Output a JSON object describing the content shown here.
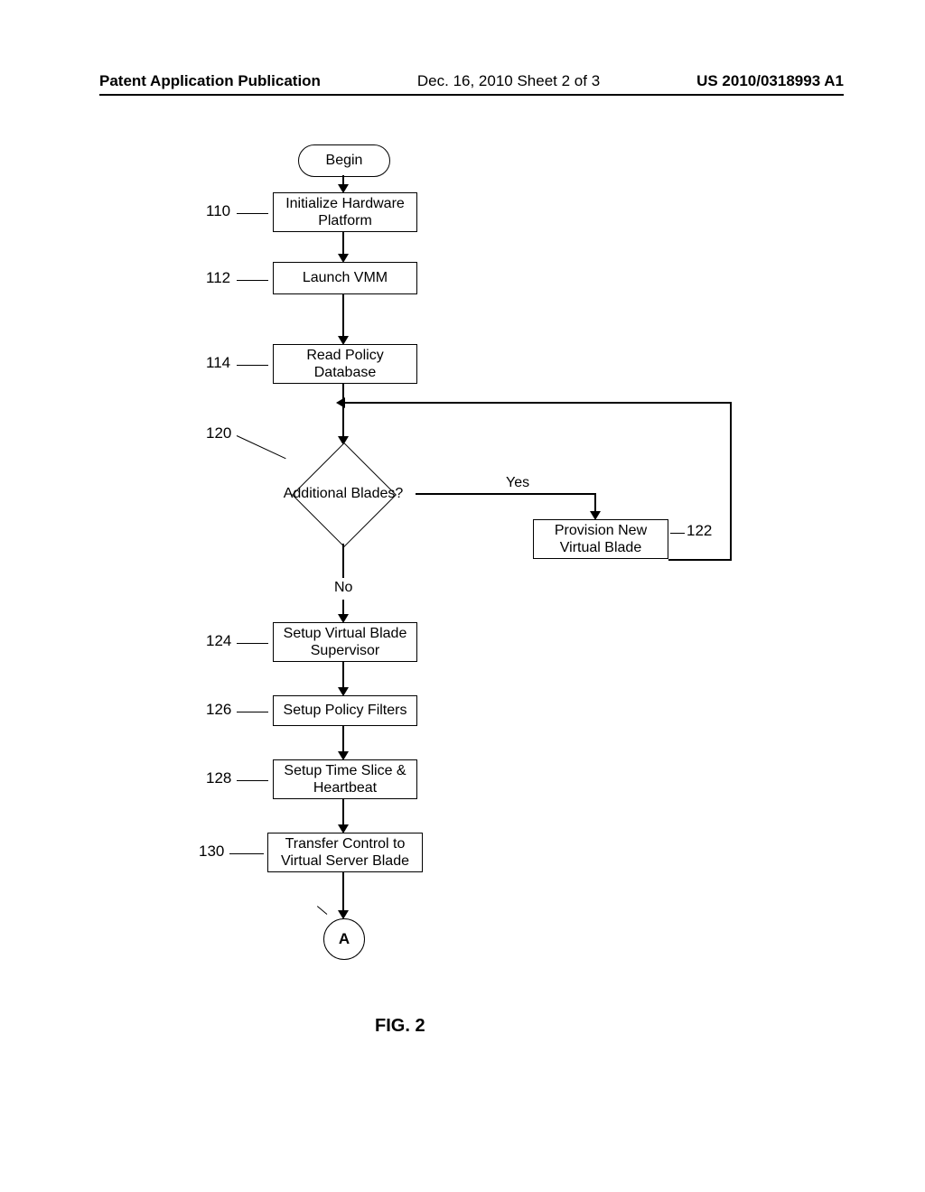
{
  "header": {
    "left": "Patent Application Publication",
    "mid": "Dec. 16, 2010  Sheet 2 of 3",
    "right": "US 2010/0318993 A1"
  },
  "figure_label": "FIG. 2",
  "terminator_begin": "Begin",
  "connector_A": "A",
  "decision": {
    "label": "Additional Blades?",
    "yes": "Yes",
    "no": "No"
  },
  "steps": {
    "s110": {
      "ref": "110",
      "text": "Initialize Hardware Platform"
    },
    "s112": {
      "ref": "112",
      "text": "Launch VMM"
    },
    "s114": {
      "ref": "114",
      "text": "Read Policy Database"
    },
    "s120": {
      "ref": "120"
    },
    "s122": {
      "ref": "122",
      "text": "Provision New Virtual Blade"
    },
    "s124": {
      "ref": "124",
      "text": "Setup Virtual Blade Supervisor"
    },
    "s126": {
      "ref": "126",
      "text": "Setup Policy Filters"
    },
    "s128": {
      "ref": "128",
      "text": "Setup Time Slice & Heartbeat"
    },
    "s130": {
      "ref": "130",
      "text": "Transfer Control to Virtual Server Blade"
    }
  }
}
